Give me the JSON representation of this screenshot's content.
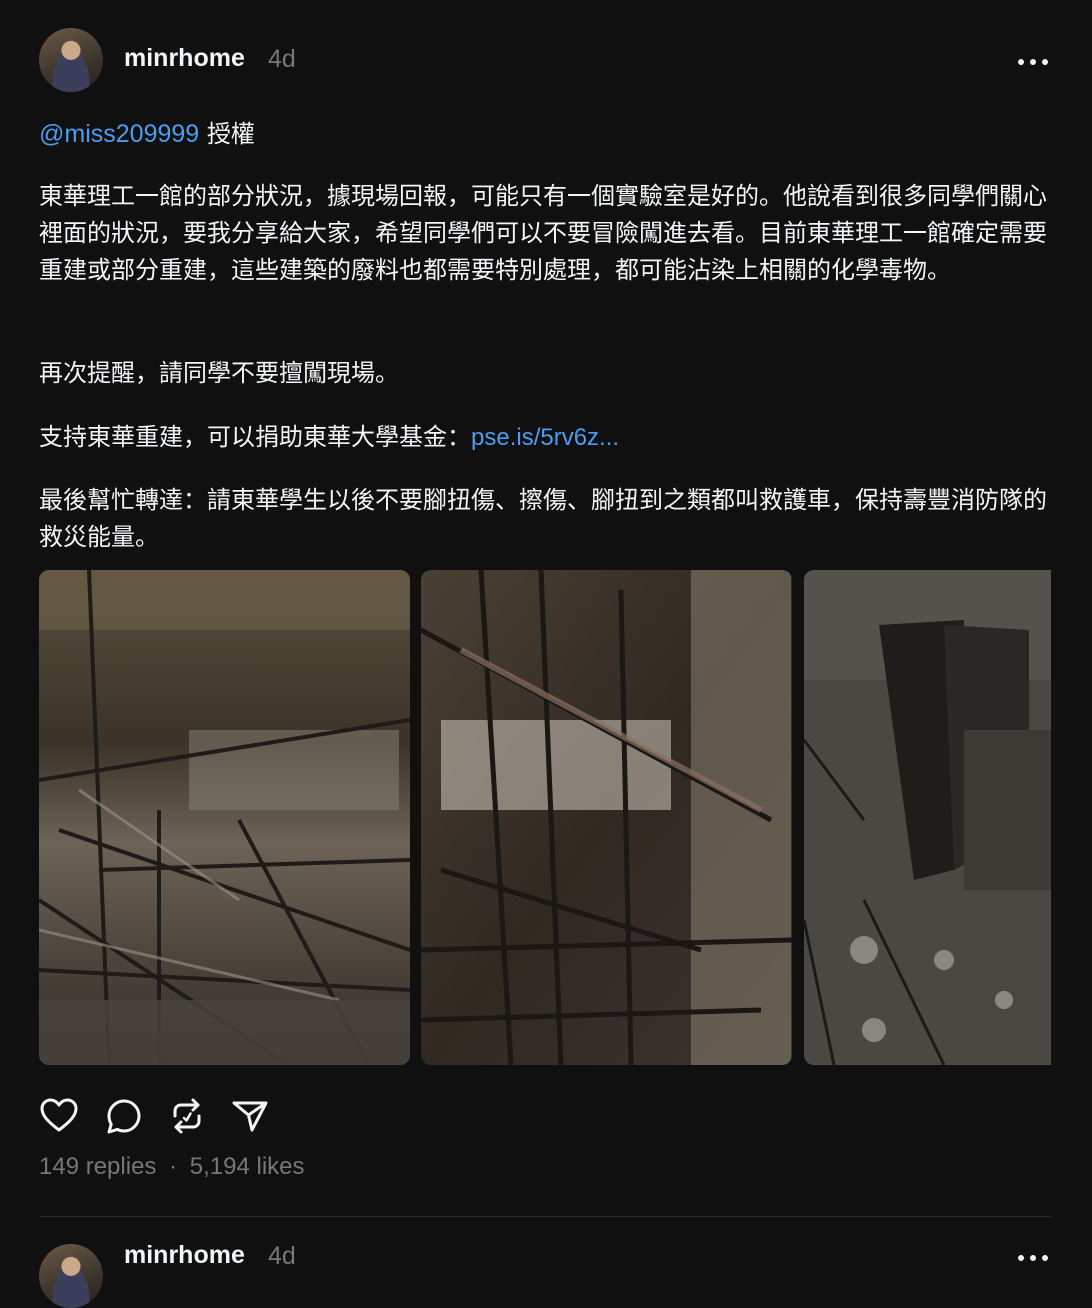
{
  "post": {
    "username": "minrhome",
    "time": "4d",
    "mention": "@miss209999",
    "mention_suffix": " 授權",
    "paragraphs": [
      "東華理工一館的部分狀況，據現場回報，可能只有一個實驗室是好的。他說看到很多同學們關心裡面的狀況，要我分享給大家，希望同學們可以不要冒險闖進去看。目前東華理工一館確定需要重建或部分重建，這些建築的廢料也都需要特別處理，都可能沾染上相關的化學毒物。",
      "再次提醒，請同學不要擅闖現場。"
    ],
    "donate_text": "支持東華重建，可以捐助東華大學基金：",
    "donate_link": "pse.is/5rv6z...",
    "last_paragraph": "最後幫忙轉達：請東華學生以後不要腳扭傷、擦傷、腳扭到之類都叫救護車，保持壽豐消防隊的救災能量。",
    "replies": "149 replies",
    "separator": "·",
    "likes": "5,194 likes",
    "actions": [
      "heart-icon",
      "comment-icon",
      "repost-icon",
      "share-icon"
    ]
  },
  "next_post": {
    "username": "minrhome",
    "time": "4d"
  },
  "colors": {
    "background": "#101010",
    "link": "#4a9df0",
    "muted": "#777777",
    "text": "#f3f5f7"
  }
}
